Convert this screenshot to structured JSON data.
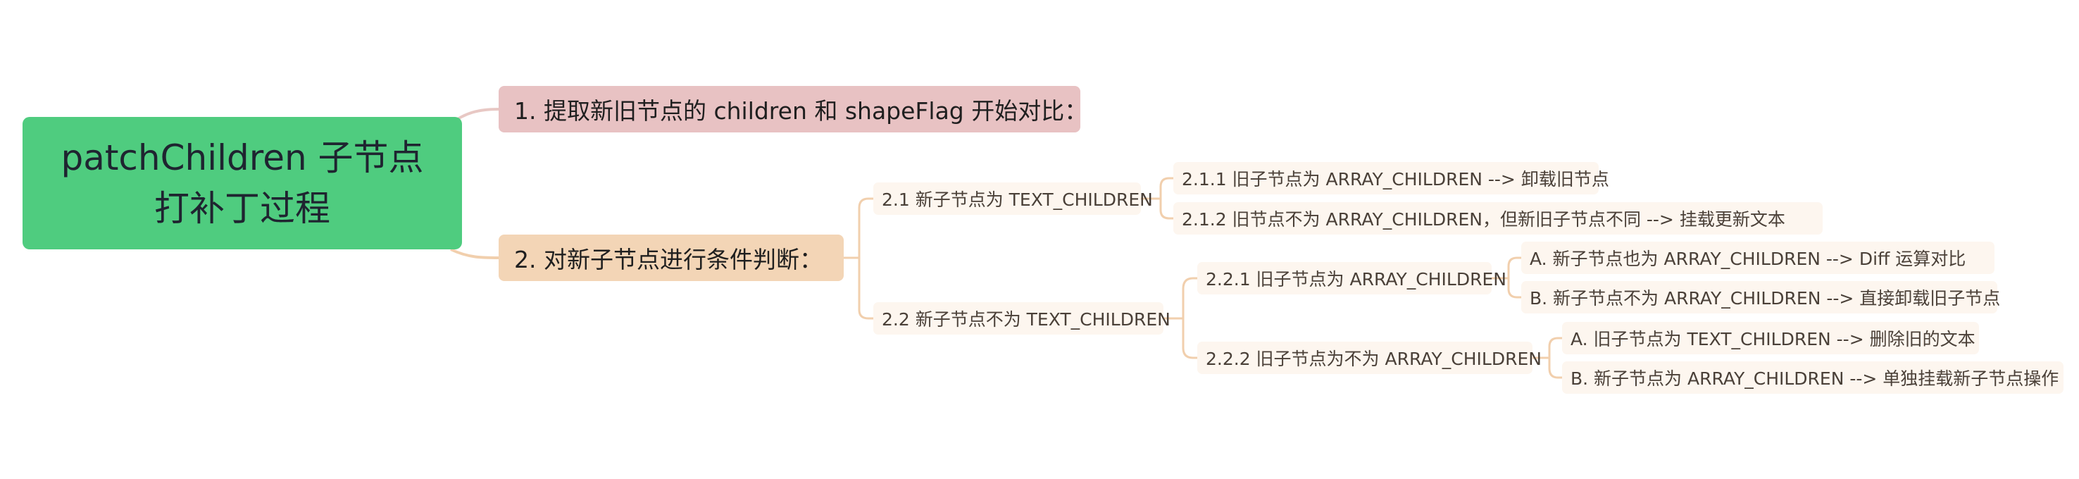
{
  "colors": {
    "root_fill": "#4fcc7f",
    "branch1_fill": "#e8c2c3",
    "branch2_fill": "#f3d5b6",
    "leaf_fill": "#fdf6ef",
    "connector_pink": "#e8c8c4",
    "connector_orange": "#f1cfad"
  },
  "root": {
    "line1": "patchChildren 子节点",
    "line2": "打补丁过程"
  },
  "branch1": {
    "label": "1. 提取新旧节点的 children 和 shapeFlag 开始对比："
  },
  "branch2": {
    "label": "2.  对新子节点进行条件判断：",
    "sub1": {
      "label": "2.1 新子节点为 TEXT_CHILDREN",
      "child1": "2.1.1 旧子节点为 ARRAY_CHILDREN --> 卸载旧节点",
      "child2": "2.1.2 旧节点不为 ARRAY_CHILDREN，但新旧子节点不同 --> 挂载更新文本"
    },
    "sub2": {
      "label": "2.2 新子节点不为 TEXT_CHILDREN",
      "sub1": {
        "label": "2.2.1 旧子节点为 ARRAY_CHILDREN",
        "childA": "A. 新子节点也为 ARRAY_CHILDREN --> Diff 运算对比",
        "childB": "B. 新子节点不为 ARRAY_CHILDREN --> 直接卸载旧子节点"
      },
      "sub2": {
        "label": "2.2.2 旧子节点为不为 ARRAY_CHILDREN",
        "childA": "A. 旧子节点为 TEXT_CHILDREN --> 删除旧的文本",
        "childB": "B. 新子节点为 ARRAY_CHILDREN --> 单独挂载新子节点操作"
      }
    }
  }
}
